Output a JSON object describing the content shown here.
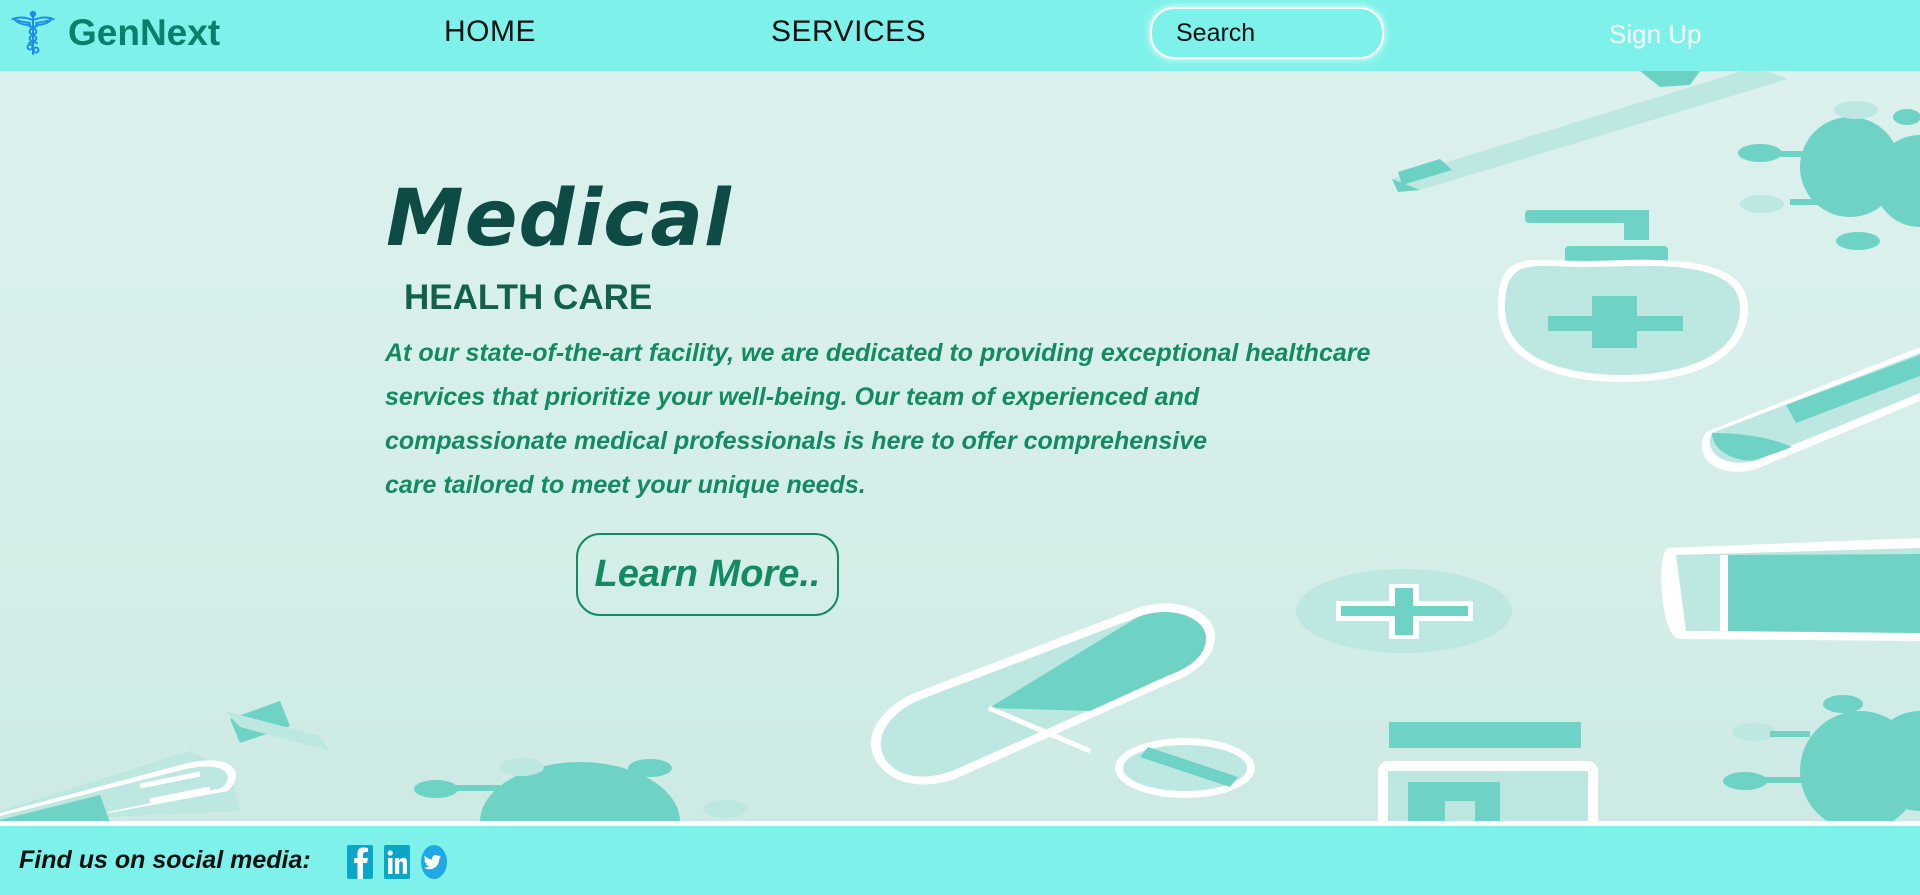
{
  "brand": {
    "name": "GenNext",
    "logo_icon": "caduceus-icon",
    "color": "#08806c"
  },
  "nav": {
    "home_label": "HOME",
    "services_label": "SERVICES",
    "search_placeholder": "Search",
    "signup_label": "Sign Up",
    "background": "#7ef2ea"
  },
  "hero": {
    "title": "Medical",
    "subtitle": "HEALTH CARE",
    "description_lines": [
      "At our state-of-the-art facility, we are dedicated to providing exceptional healthcare",
      "services that prioritize your well-being. Our team of experienced and",
      "compassionate medical professionals is here to offer comprehensive",
      "care tailored to meet your unique needs."
    ],
    "cta_label": "Learn More..",
    "accent_color": "#148a62",
    "title_color": "#0e4b45"
  },
  "footer": {
    "social_label": "Find us on social media:",
    "social_icons": [
      "facebook-icon",
      "linkedin-icon",
      "twitter-icon"
    ]
  }
}
